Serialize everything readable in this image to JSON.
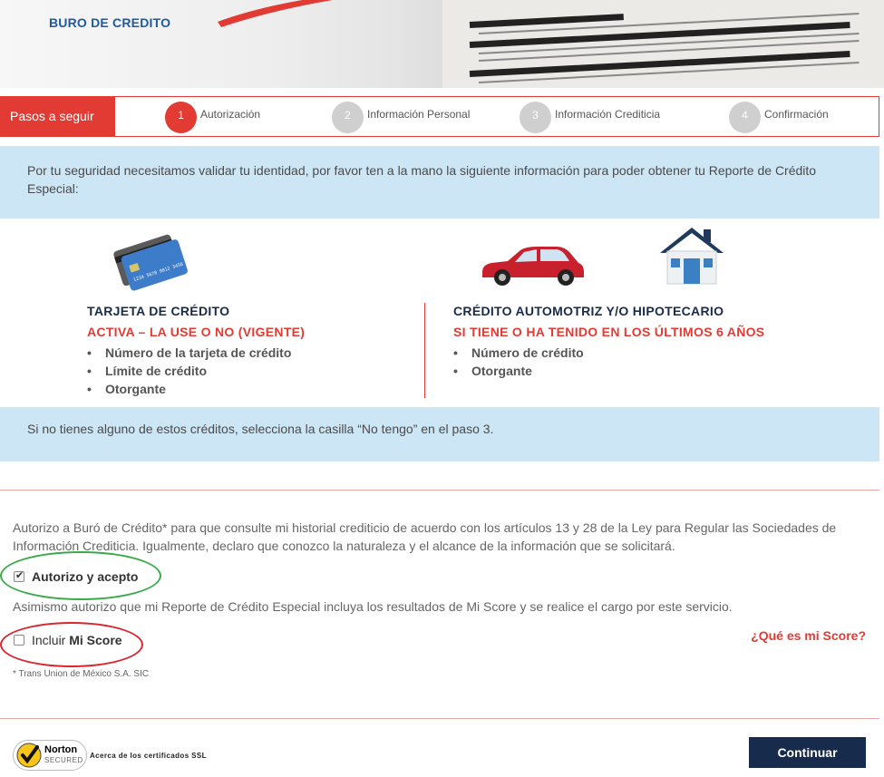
{
  "header": {
    "logo_text": "BURO DE CREDITO"
  },
  "steps": {
    "label": "Pasos a seguir",
    "items": [
      {
        "number": "1",
        "label": "Autorización",
        "active": true
      },
      {
        "number": "2",
        "label": "Información Personal",
        "active": false
      },
      {
        "number": "3",
        "label": "Información Crediticia",
        "active": false
      },
      {
        "number": "4",
        "label": "Confirmación",
        "active": false
      }
    ]
  },
  "intro": {
    "text": "Por tu seguridad necesitamos validar tu identidad, por favor ten a la mano la siguiente información para poder obtener tu Reporte de Crédito Especial:"
  },
  "requirements": {
    "card": {
      "title": "TARJETA DE CRÉDITO",
      "subtitle": "ACTIVA – LA USE O NO (VIGENTE)",
      "items": [
        "Número de la tarjeta de crédito",
        "Límite de crédito",
        "Otorgante"
      ],
      "card_number": "1234 5678 9012 3456"
    },
    "auto": {
      "title": "CRÉDITO AUTOMOTRIZ Y/O HIPOTECARIO",
      "subtitle": "SI TIENE O HA TENIDO EN LOS ÚLTIMOS 6 AÑOS",
      "items": [
        "Número de crédito",
        "Otorgante"
      ]
    }
  },
  "note": {
    "text": "Si no tienes alguno de estos créditos, selecciona la casilla “No tengo” en el paso 3."
  },
  "authorization": {
    "text": "Autorizo a Buró de Crédito* para que consulte mi historial crediticio de acuerdo con los artículos 13 y 28 de la Ley para Regular las Sociedades de Información Crediticia. Igualmente, declaro que conozco la naturaleza y el alcance de la información que se solicitará.",
    "accept_label": "Autorizo y acepto",
    "accept_checked": true,
    "score_text": "Asimismo autorizo que mi Reporte de Crédito Especial incluya los resultados de Mi Score y se realice el cargo por este servicio.",
    "score_label_prefix": "Incluir ",
    "score_label_bold": "Mi Score",
    "score_checked": false,
    "score_link": "¿Qué es mi Score?",
    "footnote": "* Trans Union de México S.A. SIC"
  },
  "footer": {
    "norton_name": "Norton",
    "norton_sub": "SECURED",
    "ssl_text": "Acerca de los certificados SSL",
    "continue_label": "Continuar"
  },
  "colors": {
    "accent_red": "#e23b33",
    "info_blue": "#cde6f5",
    "navy": "#172b4d",
    "circle_green": "#3aaa4a",
    "circle_red": "#d9262e"
  }
}
